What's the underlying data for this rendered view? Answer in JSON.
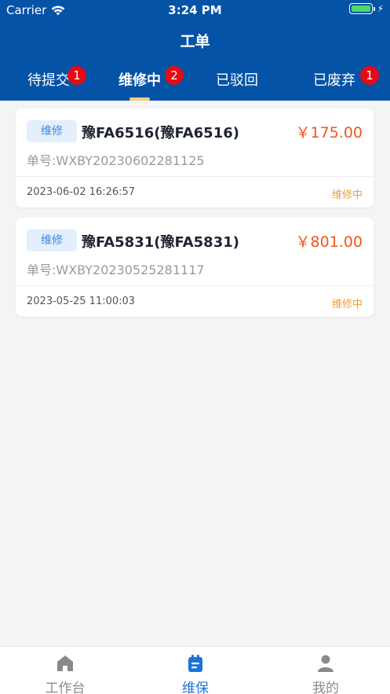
{
  "status_bar": {
    "carrier": "Carrier",
    "time": "3:24 PM"
  },
  "header": {
    "title": "工单"
  },
  "tabs": [
    {
      "label": "待提交",
      "badge": "1",
      "active": false
    },
    {
      "label": "维修中",
      "badge": "2",
      "active": true
    },
    {
      "label": "已驳回",
      "badge": "",
      "active": false
    },
    {
      "label": "已废弃",
      "badge": "1",
      "active": false
    }
  ],
  "orders": [
    {
      "tag": "维修",
      "plate": "豫FA6516(豫FA6516)",
      "price": "￥175.00",
      "order_no": "单号:WXBY20230602281125",
      "date": "2023-06-02 16:26:57",
      "status": "维修中"
    },
    {
      "tag": "维修",
      "plate": "豫FA5831(豫FA5831)",
      "price": "￥801.00",
      "order_no": "单号:WXBY20230525281117",
      "date": "2023-05-25 11:00:03",
      "status": "维修中"
    }
  ],
  "bottom_nav": [
    {
      "label": "工作台",
      "icon": "home-icon",
      "active": false
    },
    {
      "label": "维保",
      "icon": "calendar-list-icon",
      "active": true
    },
    {
      "label": "我的",
      "icon": "user-icon",
      "active": false
    }
  ],
  "colors": {
    "header_bg": "#0553a7",
    "tab_indicator": "#f1cf7a",
    "badge": "#e50b14",
    "price": "#f0561b",
    "status": "#f0a033",
    "nav_active": "#1c73d6",
    "nav_inactive": "#8a8a8a"
  }
}
